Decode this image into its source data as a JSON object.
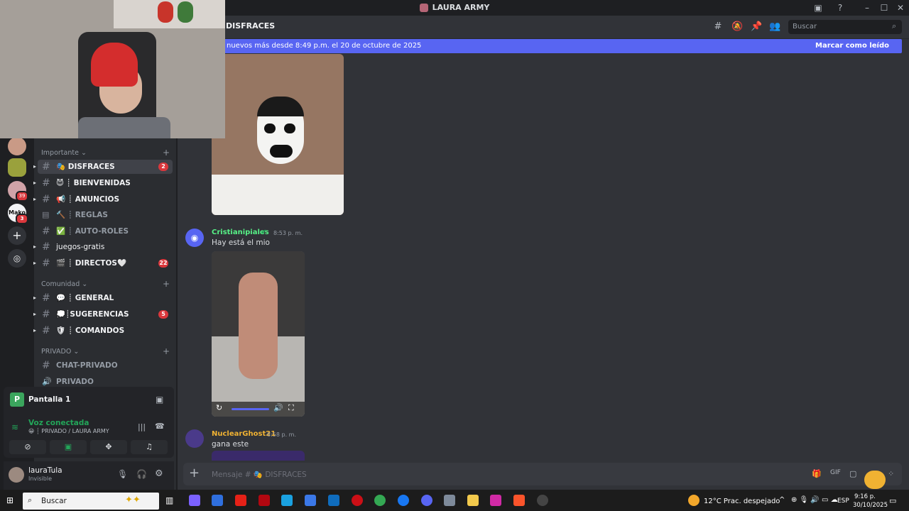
{
  "window": {
    "title": "LAURA ARMY"
  },
  "header": {
    "channel": "DISFRACES",
    "search_placeholder": "Buscar"
  },
  "new_messages_bar": {
    "text": "nuevos más desde 8:49 p.m. el 20 de octubre de 2025",
    "action": "Marcar como leído"
  },
  "sidebar": {
    "categories": [
      {
        "label": "Importante",
        "channels": [
          {
            "label": "🎭 DISFRACES",
            "badge": "2"
          },
          {
            "label": "😈 ┊ BIENVENIDAS",
            "badge": ""
          },
          {
            "label": "📢 ┊ ANUNCIOS",
            "badge": ""
          },
          {
            "label": "🔨 ┊ REGLAS",
            "badge": ""
          },
          {
            "label": "✅ ┊ AUTO-ROLES",
            "badge": ""
          },
          {
            "label": "juegos-gratis",
            "badge": ""
          },
          {
            "label": "🎬 ┊ DIRECTOS🤍",
            "badge": "22"
          }
        ]
      },
      {
        "label": "Comunidad",
        "channels": [
          {
            "label": "💬 ┊ GENERAL",
            "badge": ""
          },
          {
            "label": "💭┊SUGERENCIAS",
            "badge": "5"
          },
          {
            "label": "🛡 ┊ COMANDOS",
            "badge": ""
          }
        ]
      },
      {
        "label": "PRIVADO",
        "channels": [
          {
            "label": "CHAT-PRIVADO",
            "badge": ""
          },
          {
            "label": "PRIVADO",
            "badge": ""
          }
        ]
      }
    ]
  },
  "rail": {
    "badges": [
      "39",
      "3"
    ],
    "server_label": "Mako"
  },
  "stream_panel": {
    "title": "Pantalla 1",
    "voice_status": "Voz conectada",
    "voice_channel": "😀 ┊ PRIVADO / LAURA ARMY"
  },
  "user": {
    "name": "lauraTula",
    "status": "Invisible"
  },
  "messages": [
    {
      "author": "Cristianipiales",
      "time": "8:53 p. m.",
      "text": "Hay está el mio",
      "color": "#57f287"
    },
    {
      "author": "NuclearGhost21",
      "time": "8:58 p. m.",
      "text": "gana este",
      "color": "#f0b232"
    }
  ],
  "composer": {
    "placeholder": "Mensaje # 🎭 DISFRACES"
  },
  "taskbar": {
    "search": "Buscar",
    "weather": "12°C  Prac. despejado",
    "lang": "ESP",
    "time": "9:16 p.",
    "date": "30/10/2025"
  },
  "colors": {
    "accent": "#5865f2",
    "badge": "#da373c",
    "bg": "#313338"
  }
}
